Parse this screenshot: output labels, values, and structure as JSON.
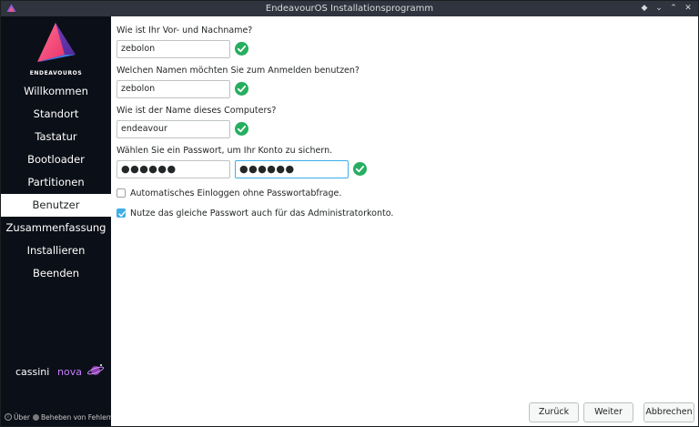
{
  "window": {
    "title": "EndeavourOS Installationsprogramm"
  },
  "sidebar": {
    "logo_text": "ENDEAVOUROS",
    "items": [
      {
        "label": "Willkommen",
        "active": false
      },
      {
        "label": "Standort",
        "active": false
      },
      {
        "label": "Tastatur",
        "active": false
      },
      {
        "label": "Bootloader",
        "active": false
      },
      {
        "label": "Partitionen",
        "active": false
      },
      {
        "label": "Benutzer",
        "active": true
      },
      {
        "label": "Zusammenfassung",
        "active": false
      },
      {
        "label": "Installieren",
        "active": false
      },
      {
        "label": "Beenden",
        "active": false
      }
    ],
    "brand_part1": "cassini",
    "brand_part2": "nova",
    "about_label": "Über",
    "debug_label": "Beheben von Fehlern"
  },
  "form": {
    "name_question": "Wie ist Ihr Vor- und Nachname?",
    "name_value": "zebolon",
    "login_question": "Welchen Namen möchten Sie zum Anmelden benutzen?",
    "login_value": "zebolon",
    "computer_question": "Wie ist der Name dieses Computers?",
    "computer_value": "endeavour",
    "password_question": "Wählen Sie ein Passwort, um Ihr Konto zu sichern.",
    "password_value": "●●●●●●",
    "password_repeat_value": "●●●●●●",
    "autologin_label": "Automatisches Einloggen ohne Passwortabfrage.",
    "autologin_checked": false,
    "same_password_label": "Nutze das gleiche Passwort auch für das Administratorkonto.",
    "same_password_checked": true
  },
  "buttons": {
    "back": "Zurück",
    "next": "Weiter",
    "cancel": "Abbrechen"
  },
  "colors": {
    "accent": "#3daee9",
    "valid": "#27ae60",
    "sidebar_bg": "#0b0f17"
  }
}
